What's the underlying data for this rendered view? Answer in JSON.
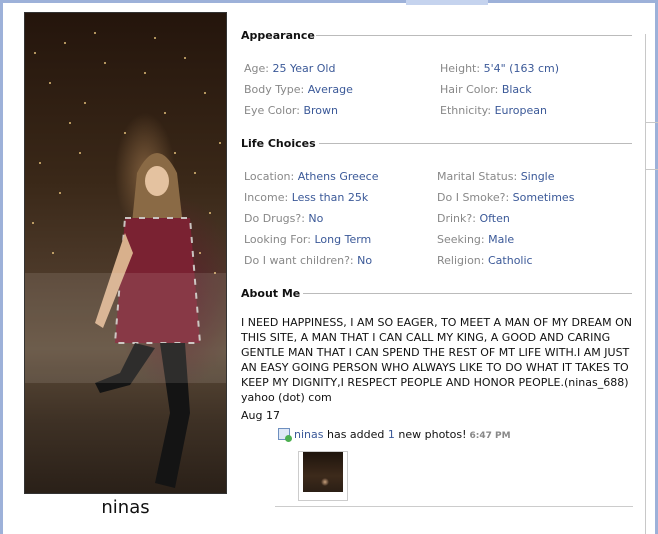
{
  "profile": {
    "username": "ninas"
  },
  "appearance": {
    "title": "Appearance",
    "age_label": "Age:",
    "age_value": "25 Year Old",
    "height_label": "Height:",
    "height_value": "5'4\" (163 cm)",
    "bodytype_label": "Body Type:",
    "bodytype_value": "Average",
    "haircolor_label": "Hair Color:",
    "haircolor_value": "Black",
    "eyecolor_label": "Eye Color:",
    "eyecolor_value": "Brown",
    "ethnicity_label": "Ethnicity:",
    "ethnicity_value": "European"
  },
  "life_choices": {
    "title": "Life Choices",
    "location_label": "Location:",
    "location_value": "Athens Greece",
    "marital_label": "Marital Status:",
    "marital_value": "Single",
    "income_label": "Income:",
    "income_value": "Less than 25k",
    "smoke_label": "Do I Smoke?:",
    "smoke_value": "Sometimes",
    "drugs_label": "Do Drugs?:",
    "drugs_value": "No",
    "drink_label": "Drink?:",
    "drink_value": "Often",
    "lookingfor_label": "Looking For:",
    "lookingfor_value": "Long Term",
    "seeking_label": "Seeking:",
    "seeking_value": "Male",
    "children_label": "Do I want children?:",
    "children_value": "No",
    "religion_label": "Religion:",
    "religion_value": "Catholic"
  },
  "about": {
    "title": "About Me",
    "text": "I NEED HAPPINESS, I AM SO EAGER, TO MEET A MAN OF MY DREAM ON THIS SITE, A MAN THAT I CAN CALL MY KING, A GOOD AND CARING GENTLE MAN THAT I CAN SPEND THE REST OF MT LIFE WITH.I AM JUST AN EASY GOING PERSON WHO ALWAYS LIKE TO DO WHAT IT TAKES TO KEEP MY DIGNITY,I RESPECT PEOPLE AND HONOR PEOPLE.(ninas_688) yahoo (dot) com"
  },
  "activity": {
    "date": "Aug 17",
    "user": "ninas",
    "text_1": "has added",
    "count": "1",
    "text_2": "new photos!",
    "time": "6:47 PM",
    "icon": "photo-added-icon"
  },
  "colors": {
    "link": "#3b5998",
    "label": "#888888",
    "border": "#9db1d9"
  }
}
